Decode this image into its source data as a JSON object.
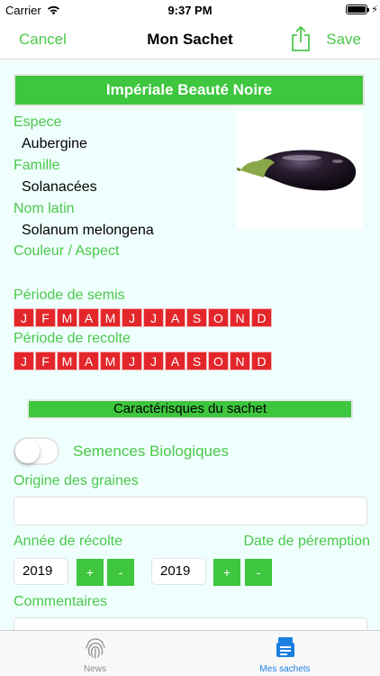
{
  "status_bar": {
    "carrier": "Carrier",
    "time": "9:37 PM"
  },
  "nav": {
    "cancel": "Cancel",
    "title": "Mon Sachet",
    "save": "Save"
  },
  "plant": {
    "name": "Impériale Beauté Noire",
    "espece_label": "Espece",
    "espece": "Aubergine",
    "famille_label": "Famille",
    "famille": "Solanacées",
    "nom_latin_label": "Nom latin",
    "nom_latin": "Solanum melongena",
    "couleur_label": "Couleur / Aspect"
  },
  "periods": {
    "semis_label": "Période de semis",
    "recolte_label": "Période de recolte",
    "months": [
      "J",
      "F",
      "M",
      "A",
      "M",
      "J",
      "J",
      "A",
      "S",
      "O",
      "N",
      "D"
    ],
    "active_color": "#e3262a"
  },
  "sachet": {
    "section_title": "Caractérisques du sachet",
    "bio_label": "Semences Biologiques",
    "bio_on": false,
    "origine_label": "Origine des graines",
    "origine_value": "",
    "annee_label": "Année de récolte",
    "annee_value": "2019",
    "peremption_label": "Date de péremption",
    "peremption_value": "2019",
    "plus": "+",
    "minus": "-",
    "commentaires_label": "Commentaires"
  },
  "tabs": [
    {
      "label": "News",
      "icon": "fingerprint-icon"
    },
    {
      "label": "Mes sachets",
      "icon": "seed-packet-icon",
      "selected": true
    }
  ],
  "colors": {
    "accent": "#4cc84c",
    "banner": "#3ec63e",
    "background": "#effffd",
    "tab_selected": "#1b7fe0"
  }
}
